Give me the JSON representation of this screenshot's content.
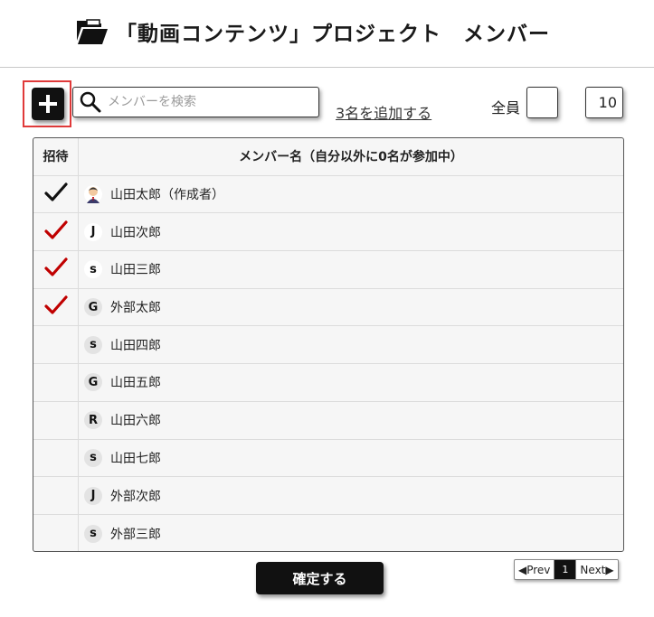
{
  "header": {
    "title": "「動画コンテンツ」プロジェクト　メンバー",
    "icon": "folder-open-icon"
  },
  "toolbar": {
    "add_icon": "plus-icon",
    "search": {
      "placeholder": "メンバーを検索",
      "value": ""
    },
    "add_count_link": "3名を追加する",
    "all_label": "全員",
    "count_value": "10"
  },
  "table": {
    "headers": {
      "invite": "招待",
      "name": "メンバー名（自分以外に0名が参加中）"
    },
    "rows": [
      {
        "checked": true,
        "check_color": "#111111",
        "avatar_letter": "",
        "avatar_type": "person",
        "name": "山田太郎（作成者）"
      },
      {
        "checked": true,
        "check_color": "#c00000",
        "avatar_letter": "J",
        "avatar_type": "white",
        "name": "山田次郎"
      },
      {
        "checked": true,
        "check_color": "#c00000",
        "avatar_letter": "s",
        "avatar_type": "white",
        "name": "山田三郎"
      },
      {
        "checked": true,
        "check_color": "#c00000",
        "avatar_letter": "G",
        "avatar_type": "grey",
        "name": "外部太郎"
      },
      {
        "checked": false,
        "check_color": "",
        "avatar_letter": "s",
        "avatar_type": "grey",
        "name": "山田四郎"
      },
      {
        "checked": false,
        "check_color": "",
        "avatar_letter": "G",
        "avatar_type": "grey",
        "name": "山田五郎"
      },
      {
        "checked": false,
        "check_color": "",
        "avatar_letter": "R",
        "avatar_type": "grey",
        "name": "山田六郎"
      },
      {
        "checked": false,
        "check_color": "",
        "avatar_letter": "s",
        "avatar_type": "grey",
        "name": "山田七郎"
      },
      {
        "checked": false,
        "check_color": "",
        "avatar_letter": "J",
        "avatar_type": "grey",
        "name": "外部次郎"
      },
      {
        "checked": false,
        "check_color": "",
        "avatar_letter": "s",
        "avatar_type": "grey",
        "name": "外部三郎"
      }
    ]
  },
  "footer": {
    "confirm_label": "確定する",
    "pager": {
      "prev": "◀Prev",
      "current": "1",
      "next": "Next▶"
    }
  }
}
